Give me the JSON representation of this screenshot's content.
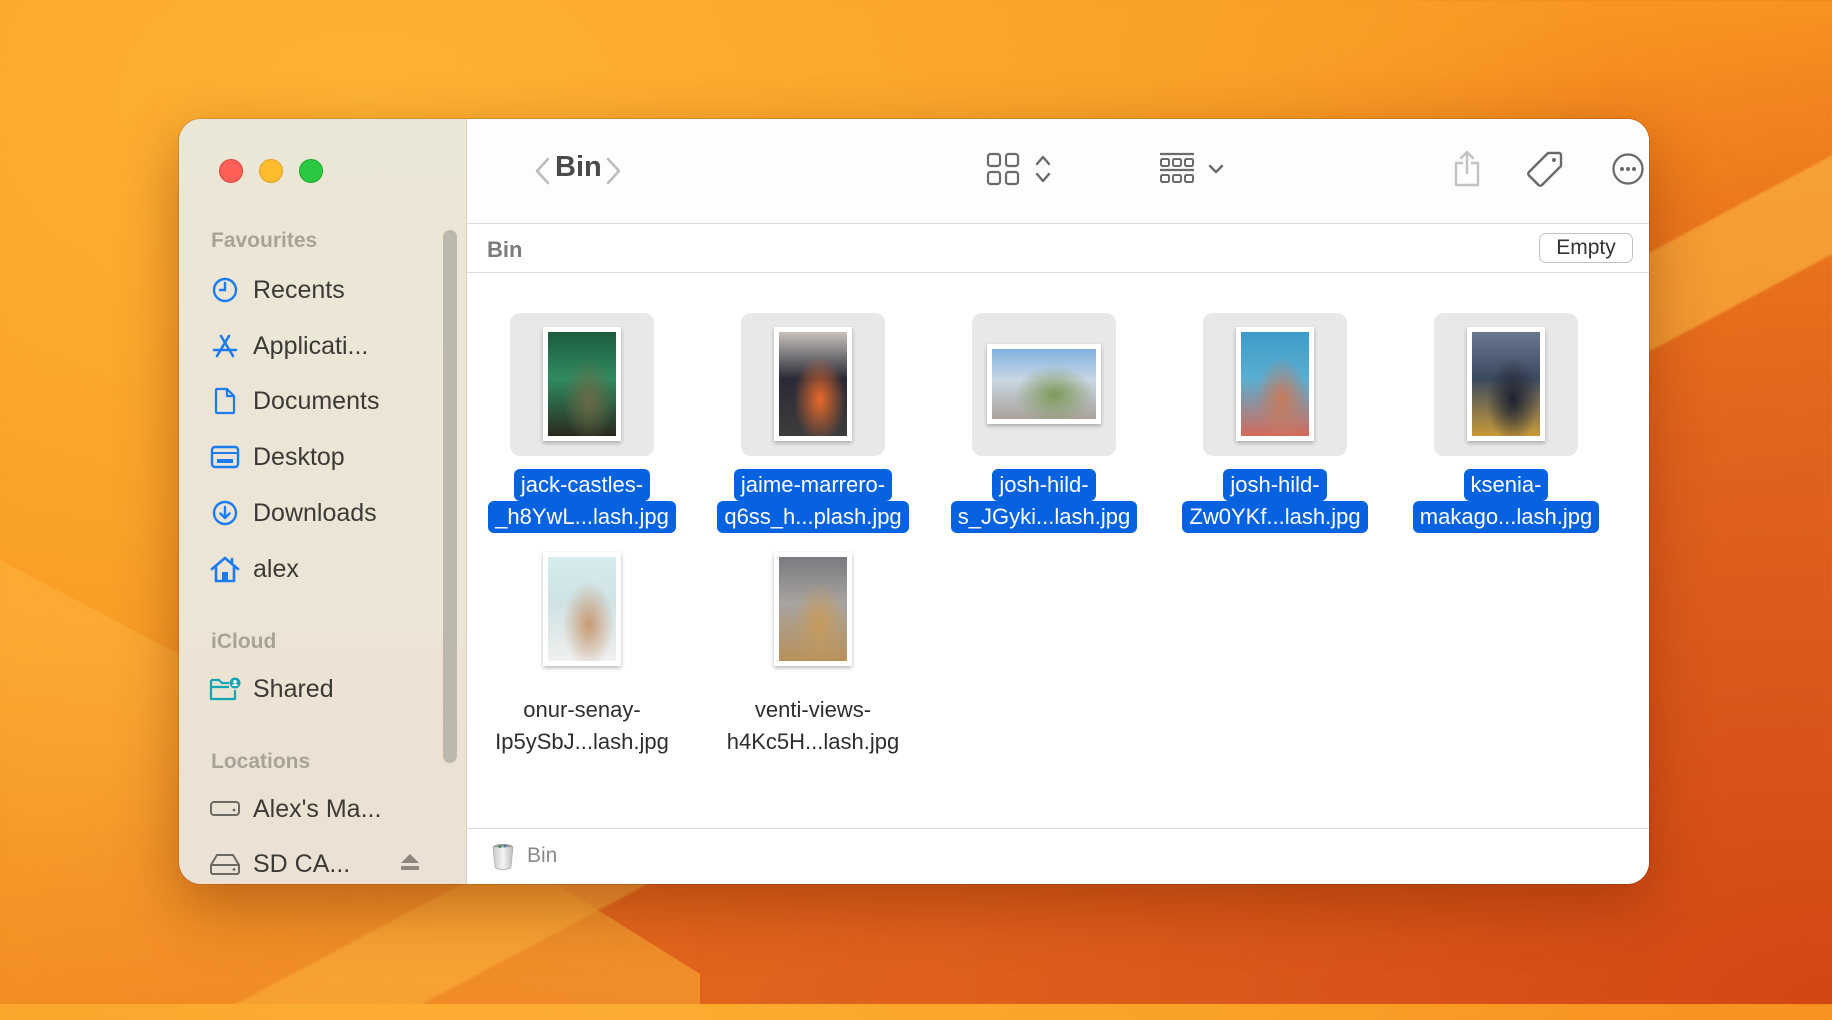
{
  "window": {
    "title": "Bin",
    "traffic_lights": {
      "close": "#fe5f57",
      "minimize": "#febc2e",
      "maximize": "#28c840"
    }
  },
  "sidebar": {
    "sections": [
      {
        "title": "Favourites",
        "items": [
          {
            "label": "Recents",
            "icon": "clock-icon"
          },
          {
            "label": "Applicati...",
            "icon": "applications-icon"
          },
          {
            "label": "Documents",
            "icon": "document-icon"
          },
          {
            "label": "Desktop",
            "icon": "desktop-icon"
          },
          {
            "label": "Downloads",
            "icon": "download-icon"
          },
          {
            "label": "alex",
            "icon": "home-icon"
          }
        ]
      },
      {
        "title": "iCloud",
        "items": [
          {
            "label": "Shared",
            "icon": "shared-folder-icon"
          }
        ]
      },
      {
        "title": "Locations",
        "items": [
          {
            "label": "Alex's Ma...",
            "icon": "internal-drive-icon"
          },
          {
            "label": "SD CA...",
            "icon": "external-drive-icon",
            "ejectable": true
          }
        ]
      }
    ],
    "accent_color": "#1a7cf0",
    "icloud_color": "#13a4b5"
  },
  "toolbar": {
    "back_label": "Back",
    "forward_label": "Forward",
    "title": "Bin",
    "view_icon": "icon-grid-view-icon",
    "group_icon": "group-by-icon",
    "share_icon": "share-icon",
    "tag_icon": "tag-icon",
    "more_icon": "more-actions-icon",
    "search_icon": "search-icon"
  },
  "pathbar": {
    "title": "Bin",
    "empty_button": "Empty"
  },
  "files": [
    {
      "line1": "jack-castles-",
      "line2": "_h8YwL...lash.jpg",
      "selected": true,
      "colors": [
        "#1c5b3f",
        "#2f8b5f",
        "#6a6a48",
        "#2a2a1e"
      ]
    },
    {
      "line1": "jaime-marrero-",
      "line2": "q6ss_h...plash.jpg",
      "selected": true,
      "colors": [
        "#c8c2bc",
        "#2a2a36",
        "#e86a2c",
        "#3d3d3d"
      ]
    },
    {
      "line1": "josh-hild-",
      "line2": "s_JGyki...lash.jpg",
      "selected": true,
      "colors": [
        "#7fb2e0",
        "#c9d7e4",
        "#7c9a5a",
        "#a8a198"
      ]
    },
    {
      "line1": "josh-hild-",
      "line2": "Zw0YKf...lash.jpg",
      "selected": true,
      "colors": [
        "#3d9bc8",
        "#5aaed2",
        "#c87a5a",
        "#d46a5a"
      ]
    },
    {
      "line1": "ksenia-",
      "line2": "makago...lash.jpg",
      "selected": true,
      "colors": [
        "#6a7890",
        "#3c4a60",
        "#1e2230",
        "#c79a3a"
      ]
    },
    {
      "line1": "onur-senay-",
      "line2": "Ip5ySbJ...lash.jpg",
      "selected": false,
      "colors": [
        "#d6ecef",
        "#cfe2e4",
        "#c89a74",
        "#f0f0f0"
      ]
    },
    {
      "line1": "venti-views-",
      "line2": "h4Kc5H...lash.jpg",
      "selected": false,
      "colors": [
        "#7a7a80",
        "#a8a4a0",
        "#c69a5c",
        "#b8905a"
      ]
    }
  ],
  "statusbar": {
    "label": "Bin",
    "icon": "trash-icon"
  }
}
